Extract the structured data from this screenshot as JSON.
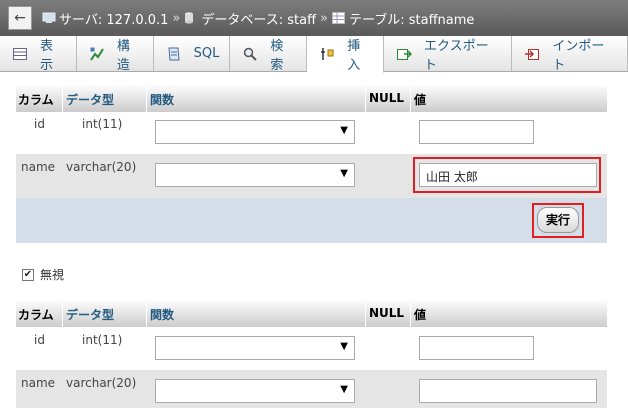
{
  "breadcrumb": {
    "back": "←",
    "server": "サーバ: 127.0.0.1",
    "database": "データベース: staff",
    "table": "テーブル: staffname",
    "separator": "»"
  },
  "tabs": [
    {
      "label": "表示",
      "icon": "browse-icon"
    },
    {
      "label": "構造",
      "icon": "structure-icon"
    },
    {
      "label": "SQL",
      "icon": "sql-icon"
    },
    {
      "label": "検索",
      "icon": "search-icon"
    },
    {
      "label": "挿入",
      "icon": "insert-icon",
      "active": true
    },
    {
      "label": "エクスポート",
      "icon": "export-icon"
    },
    {
      "label": "インポート",
      "icon": "import-icon"
    }
  ],
  "columns": {
    "column": "カラム",
    "type": "データ型",
    "function": "関数",
    "null": "NULL",
    "value": "値"
  },
  "form1": {
    "rows": [
      {
        "name": "id",
        "type": "int(11)",
        "value": ""
      },
      {
        "name": "name",
        "type": "varchar(20)",
        "value": "山田 太郎"
      }
    ],
    "execute": "実行"
  },
  "ignore_label": "無視",
  "ignore_checked": "✔",
  "form2": {
    "rows": [
      {
        "name": "id",
        "type": "int(11)",
        "value": ""
      },
      {
        "name": "name",
        "type": "varchar(20)",
        "value": ""
      }
    ]
  },
  "colors": {
    "highlight": "#e02020",
    "link": "#235a81",
    "band": "#d5dde8"
  }
}
